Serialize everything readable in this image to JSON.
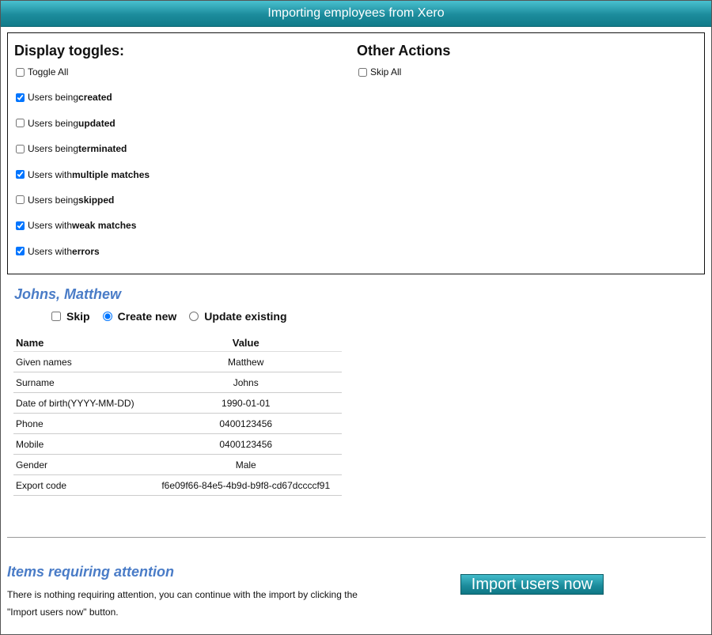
{
  "window": {
    "title": "Importing employees from Xero"
  },
  "display_toggles": {
    "heading": "Display toggles:",
    "items": [
      {
        "prefix": "Toggle All",
        "emphasis": "",
        "checked": false
      },
      {
        "prefix": "Users being ",
        "emphasis": "created",
        "checked": true
      },
      {
        "prefix": "Users being ",
        "emphasis": "updated",
        "checked": false
      },
      {
        "prefix": "Users being ",
        "emphasis": "terminated",
        "checked": false
      },
      {
        "prefix": "Users with ",
        "emphasis": "multiple matches",
        "checked": true
      },
      {
        "prefix": "Users being ",
        "emphasis": "skipped",
        "checked": false
      },
      {
        "prefix": "Users with ",
        "emphasis": "weak matches",
        "checked": true
      },
      {
        "prefix": "Users with ",
        "emphasis": "errors",
        "checked": true
      }
    ]
  },
  "other_actions": {
    "heading": "Other Actions",
    "skip_all": {
      "label": "Skip All",
      "checked": false
    }
  },
  "employee": {
    "name": "Johns, Matthew",
    "actions": {
      "skip": {
        "label": "Skip",
        "checked": false
      },
      "create_new": {
        "label": "Create new",
        "selected": true
      },
      "update_existing": {
        "label": "Update existing",
        "selected": false
      }
    },
    "table": {
      "headers": {
        "name": "Name",
        "value": "Value"
      },
      "rows": [
        {
          "name": "Given names",
          "value": "Matthew"
        },
        {
          "name": "Surname",
          "value": "Johns"
        },
        {
          "name": "Date of birth(YYYY-MM-DD)",
          "value": "1990-01-01"
        },
        {
          "name": "Phone",
          "value": "0400123456"
        },
        {
          "name": "Mobile",
          "value": "0400123456"
        },
        {
          "name": "Gender",
          "value": "Male"
        },
        {
          "name": "Export code",
          "value": "f6e09f66-84e5-4b9d-b9f8-cd67dccccf91"
        }
      ]
    }
  },
  "attention": {
    "heading": "Items requiring attention",
    "text": "There is nothing requiring attention, you can continue with the import by clicking the \"Import users now\" button."
  },
  "import_button": {
    "label": "Import users now"
  }
}
